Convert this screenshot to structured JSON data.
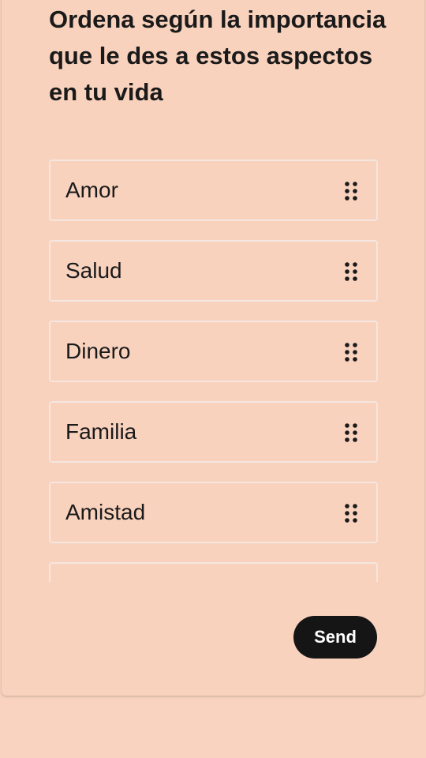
{
  "question": "Ordena según la importancia que le des a estos aspectos en tu vida",
  "items": [
    {
      "label": "Amor"
    },
    {
      "label": "Salud"
    },
    {
      "label": "Dinero"
    },
    {
      "label": "Familia"
    },
    {
      "label": "Amistad"
    },
    {
      "label": ""
    }
  ],
  "drag_icon": "drag-handle-icon",
  "send_label": "Send",
  "colors": {
    "background": "#f9d3bf",
    "card": "#f9d2bd",
    "text": "#1a1a1a",
    "item_border": "#f4e6e0",
    "button": "#151515",
    "button_text": "#ffffff"
  }
}
